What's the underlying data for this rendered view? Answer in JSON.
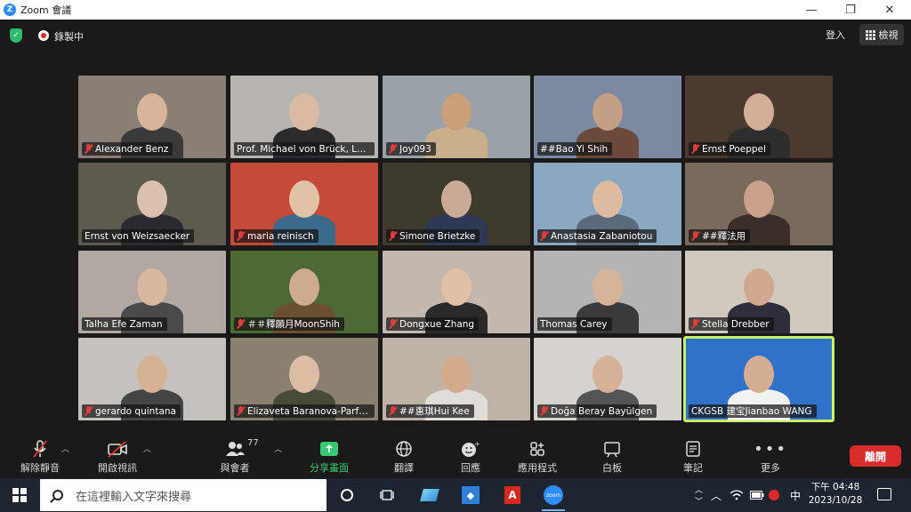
{
  "window": {
    "title": "Zoom 會議",
    "logo_letter": "Z",
    "controls": {
      "minimize": "—",
      "maximize": "❐",
      "close": "✕"
    }
  },
  "topbar": {
    "recording_label": "錄製中",
    "login_label": "登入",
    "view_label": "檢視"
  },
  "participants": [
    {
      "name": "Alexander Benz",
      "muted": true,
      "bg": "#8a7f76",
      "skin": "#d7b49a",
      "cloth": "#3a3a3a"
    },
    {
      "name": "Prof. Michael von Brück, LMU",
      "muted": false,
      "bg": "#b8b5b0",
      "skin": "#d9bba5",
      "cloth": "#2b2b2b"
    },
    {
      "name": "Joy093",
      "muted": true,
      "bg": "#9aa2a8",
      "skin": "#c9a07a",
      "cloth": "#c9b08a"
    },
    {
      "name": "##Bao Yi Shih",
      "muted": false,
      "bg": "#7b8aa0",
      "skin": "#c59f85",
      "cloth": "#6a4a3a"
    },
    {
      "name": "Ernst Poeppel",
      "muted": true,
      "bg": "#4a3a30",
      "skin": "#d4ae98",
      "cloth": "#2e2e2e"
    },
    {
      "name": "Ernst von Weizsaecker",
      "muted": false,
      "bg": "#5e5a50",
      "skin": "#dcbfae",
      "cloth": "#2a2a30"
    },
    {
      "name": "maria reinisch",
      "muted": true,
      "bg": "#c44a3a",
      "skin": "#e0c2a8",
      "cloth": "#3c6a8a"
    },
    {
      "name": "Simone Brietzke",
      "muted": true,
      "bg": "#3e3a2e",
      "skin": "#c8aa96",
      "cloth": "#2e3a55"
    },
    {
      "name": "Anastasia Zabaniotou",
      "muted": true,
      "bg": "#8ca8c0",
      "skin": "#dcbba0",
      "cloth": "#5a6a7a"
    },
    {
      "name": "##釋法用",
      "muted": true,
      "bg": "#7a6a5c",
      "skin": "#c9a088",
      "cloth": "#3a2e28"
    },
    {
      "name": "Talha Efe Zaman",
      "muted": false,
      "bg": "#b0a9a2",
      "skin": "#d8b89c",
      "cloth": "#4a4a4a"
    },
    {
      "name": "＃＃釋願月MoonShih",
      "muted": true,
      "bg": "#4e6a34",
      "skin": "#cfaa8e",
      "cloth": "#6a5030"
    },
    {
      "name": "Dongxue Zhang",
      "muted": true,
      "bg": "#c2b8b0",
      "skin": "#e0c0a6",
      "cloth": "#2a2a2a"
    },
    {
      "name": "Thomas Carey",
      "muted": false,
      "bg": "#b6b4b2",
      "skin": "#d6b49a",
      "cloth": "#3a3a3a"
    },
    {
      "name": "Stella Drebber",
      "muted": true,
      "bg": "#cfc9c0",
      "skin": "#cfa88e",
      "cloth": "#2e2e3a"
    },
    {
      "name": "gerardo quintana",
      "muted": true,
      "bg": "#c5c1bc",
      "skin": "#d6b294",
      "cloth": "#444"
    },
    {
      "name": "Elizaveta Baranova-Parfenova",
      "muted": true,
      "bg": "#8a8070",
      "skin": "#dcbca4",
      "cloth": "#4a4a3a"
    },
    {
      "name": "##惠琪Hui Kee",
      "muted": true,
      "bg": "#bfb3a8",
      "skin": "#d2ab8c",
      "cloth": "#e0dcd8"
    },
    {
      "name": "Doğa Beray Bayülgen",
      "muted": true,
      "bg": "#d6d2ce",
      "skin": "#d6b098",
      "cloth": "#555"
    },
    {
      "name": "CKGSB 建宝Jianbao WANG",
      "muted": false,
      "bg": "#2f73c9",
      "skin": "#d4ae92",
      "cloth": "#f2f2f2",
      "active": true
    }
  ],
  "toolbar": {
    "unmute": "解除靜音",
    "start_video": "開啟視訊",
    "participants": "與會者",
    "participants_count": "77",
    "share": "分享畫面",
    "translate": "翻譯",
    "reactions": "回應",
    "apps": "應用程式",
    "whiteboard": "白板",
    "notes": "筆記",
    "more": "更多",
    "leave": "離開"
  },
  "taskbar": {
    "search_placeholder": "在這裡輸入文字來搜尋",
    "ime": "中",
    "time": "下午 04:48",
    "date": "2023/10/28",
    "zoom_label": "zoom"
  }
}
